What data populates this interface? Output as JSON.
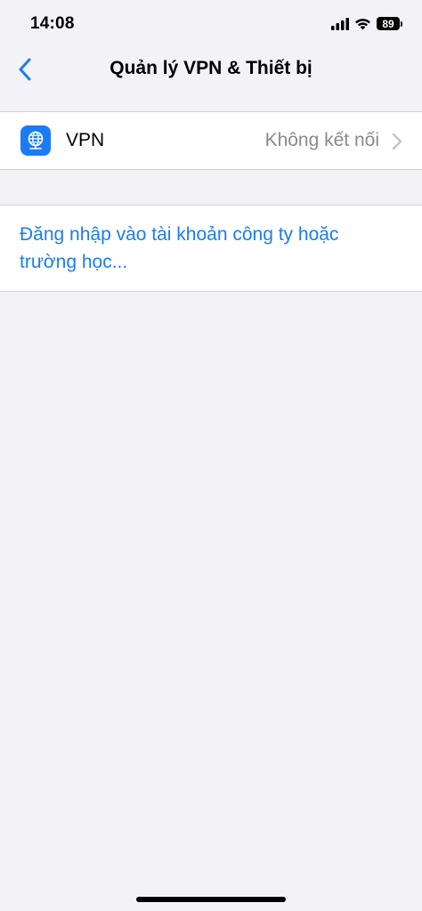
{
  "status_bar": {
    "time": "14:08",
    "battery": "89",
    "icons": [
      "signal-icon",
      "wifi-icon",
      "battery-icon"
    ]
  },
  "nav": {
    "title": "Quản lý VPN & Thiết bị",
    "back_icon": "chevron-left-icon"
  },
  "vpn_row": {
    "label": "VPN",
    "status": "Không kết nối",
    "icon": "vpn-globe-icon",
    "chevron": "chevron-right-icon"
  },
  "signin": {
    "link_text": "Đăng nhập vào tài khoản công ty hoặc trường học..."
  },
  "colors": {
    "background": "#f2f2f7",
    "accent": "#1a7cf5",
    "secondary_text": "#8a8a8e"
  }
}
